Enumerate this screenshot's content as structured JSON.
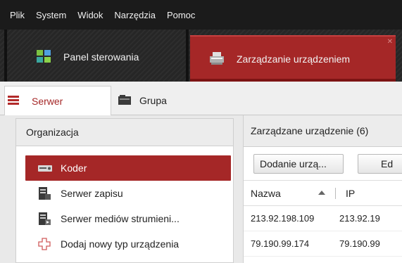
{
  "menubar": {
    "items": [
      "Plik",
      "System",
      "Widok",
      "Narzędzia",
      "Pomoc"
    ]
  },
  "main_tabs": [
    {
      "label": "Panel sterowania",
      "icon": "dashboard-icon",
      "active": false
    },
    {
      "label": "Zarządzanie urządzeniem",
      "icon": "device-management-icon",
      "active": true
    }
  ],
  "sub_tabs": [
    {
      "label": "Serwer",
      "icon": "server-icon",
      "active": true
    },
    {
      "label": "Grupa",
      "icon": "group-icon",
      "active": false
    }
  ],
  "left_panel": {
    "header": "Organizacja",
    "items": [
      {
        "label": "Koder",
        "icon": "encoder-icon",
        "selected": true
      },
      {
        "label": "Serwer zapisu",
        "icon": "storage-server-icon",
        "selected": false
      },
      {
        "label": "Serwer mediów strumieni...",
        "icon": "stream-media-server-icon",
        "selected": false
      },
      {
        "label": "Dodaj nowy typ urządzenia",
        "icon": "add-device-type-icon",
        "selected": false
      }
    ]
  },
  "right_panel": {
    "header": "Zarządzane urządzenie (6)",
    "buttons": {
      "add_device": "Dodanie urzą...",
      "edit": "Ed"
    },
    "columns": [
      "Nazwa",
      "IP"
    ],
    "rows": [
      {
        "name": "213.92.198.109",
        "ip": "213.92.19"
      },
      {
        "name": "79.190.99.174",
        "ip": "79.190.99"
      }
    ]
  },
  "colors": {
    "accent": "#a52727",
    "menubar": "#1b1b1b",
    "tabbar": "#262626"
  }
}
